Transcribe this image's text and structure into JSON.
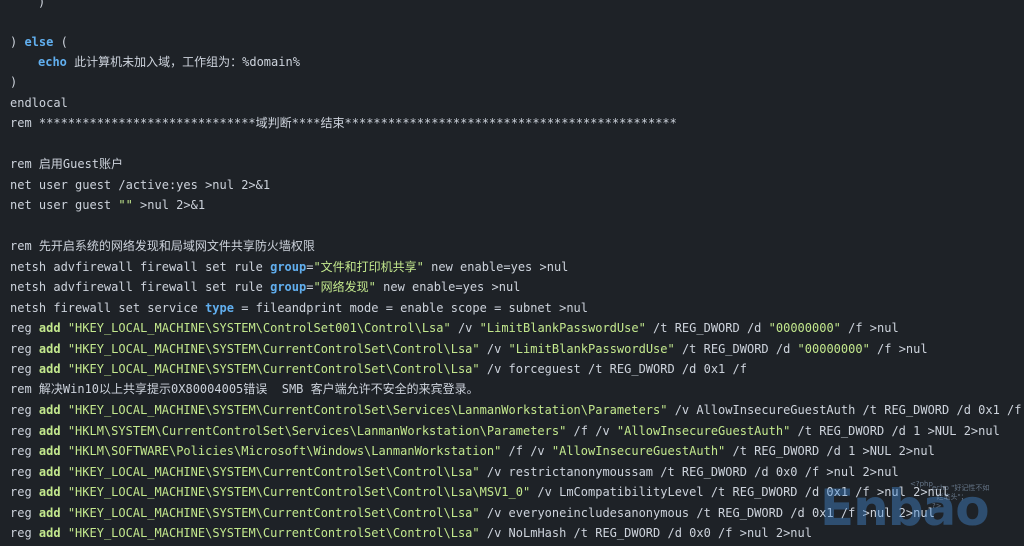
{
  "code": {
    "l01": ")",
    "l02a": ") ",
    "l02b": "else",
    "l02c": " (",
    "l03a": "echo",
    "l03b": " 此计算机未加入域，工作组为：%domain%",
    "l04": ")",
    "l05": "endlocal",
    "l06": "rem ******************************域判断****结束**********************************************",
    "l07": "rem 启用Guest账户",
    "l08": "net user guest /active:yes >nul 2>&1",
    "l09a": "net user guest ",
    "l09b": "\"\"",
    "l09c": " >nul 2>&1",
    "l10": "rem 先开启系统的网络发现和局域网文件共享防火墙权限",
    "l11a": "netsh advfirewall firewall set rule ",
    "l11b": "group",
    "l11c": "=",
    "l11d": "\"文件和打印机共享\"",
    "l11e": " new enable=yes >nul",
    "l12a": "netsh advfirewall firewall set rule ",
    "l12b": "group",
    "l12c": "=",
    "l12d": "\"网络发现\"",
    "l12e": " new enable=yes >nul",
    "l13a": "netsh firewall set service ",
    "l13b": "type",
    "l13c": " = fileandprint mode = enable scope = subnet >nul",
    "l14a": "reg ",
    "l14b": "add",
    "l14c": " ",
    "l14d": "\"HKEY_LOCAL_MACHINE\\SYSTEM\\ControlSet001\\Control\\Lsa\"",
    "l14e": " /v ",
    "l14f": "\"LimitBlankPasswordUse\"",
    "l14g": " /t REG_DWORD /d ",
    "l14h": "\"00000000\"",
    "l14i": " /f >nul",
    "l15a": "reg ",
    "l15b": "add",
    "l15c": " ",
    "l15d": "\"HKEY_LOCAL_MACHINE\\SYSTEM\\CurrentControlSet\\Control\\Lsa\"",
    "l15e": " /v ",
    "l15f": "\"LimitBlankPasswordUse\"",
    "l15g": " /t REG_DWORD /d ",
    "l15h": "\"00000000\"",
    "l15i": " /f >nul",
    "l16a": "reg ",
    "l16b": "add",
    "l16c": " ",
    "l16d": "\"HKEY_LOCAL_MACHINE\\SYSTEM\\CurrentControlSet\\Control\\Lsa\"",
    "l16e": " /v forceguest /t REG_DWORD /d 0x1 /f",
    "l17": "rem 解决Win10以上共享提示0X80004005错误  SMB 客户端允许不安全的来宾登录。",
    "l18a": "reg ",
    "l18b": "add",
    "l18c": " ",
    "l18d": "\"HKEY_LOCAL_MACHINE\\SYSTEM\\CurrentControlSet\\Services\\LanmanWorkstation\\Parameters\"",
    "l18e": " /v AllowInsecureGuestAuth /t REG_DWORD /d 0x1 /f",
    "l19a": "reg ",
    "l19b": "add",
    "l19c": " ",
    "l19d": "\"HKLM\\SYSTEM\\CurrentControlSet\\Services\\LanmanWorkstation\\Parameters\"",
    "l19e": " /f /v ",
    "l19f": "\"AllowInsecureGuestAuth\"",
    "l19g": " /t REG_DWORD /d 1 >NUL 2>nul",
    "l20a": "reg ",
    "l20b": "add",
    "l20c": " ",
    "l20d": "\"HKLM\\SOFTWARE\\Policies\\Microsoft\\Windows\\LanmanWorkstation\"",
    "l20e": " /f /v ",
    "l20f": "\"AllowInsecureGuestAuth\"",
    "l20g": " /t REG_DWORD /d 1 >NUL 2>nul",
    "l21a": "reg ",
    "l21b": "add",
    "l21c": " ",
    "l21d": "\"HKEY_LOCAL_MACHINE\\SYSTEM\\CurrentControlSet\\Control\\Lsa\"",
    "l21e": " /v restrictanonymoussam /t REG_DWORD /d 0x0 /f >nul 2>nul",
    "l22a": "reg ",
    "l22b": "add",
    "l22c": " ",
    "l22d": "\"HKEY_LOCAL_MACHINE\\SYSTEM\\CurrentControlSet\\Control\\Lsa\\MSV1_0\"",
    "l22e": " /v LmCompatibilityLevel /t REG_DWORD /d 0x1 /f >nul 2>nul",
    "l23a": "reg ",
    "l23b": "add",
    "l23c": " ",
    "l23d": "\"HKEY_LOCAL_MACHINE\\SYSTEM\\CurrentControlSet\\Control\\Lsa\"",
    "l23e": " /v everyoneincludesanonymous /t REG_DWORD /d 0x1 /f >nul 2>nul",
    "l24a": "reg ",
    "l24b": "add",
    "l24c": " ",
    "l24d": "\"HKEY_LOCAL_MACHINE\\SYSTEM\\CurrentControlSet\\Control\\Lsa\"",
    "l24e": " /v NoLmHash /t REG_DWORD /d 0x0 /f >nul 2>nul"
  },
  "watermark": {
    "logo": "Enbao",
    "small_top": "<?php",
    "small_right": "echo \"好记性不如\n  烂笔头\"；\n?>"
  },
  "colors": {
    "background": "#1e2227",
    "text": "#cdd3dc",
    "keyword": "#61afef",
    "string": "#c3e88d"
  }
}
